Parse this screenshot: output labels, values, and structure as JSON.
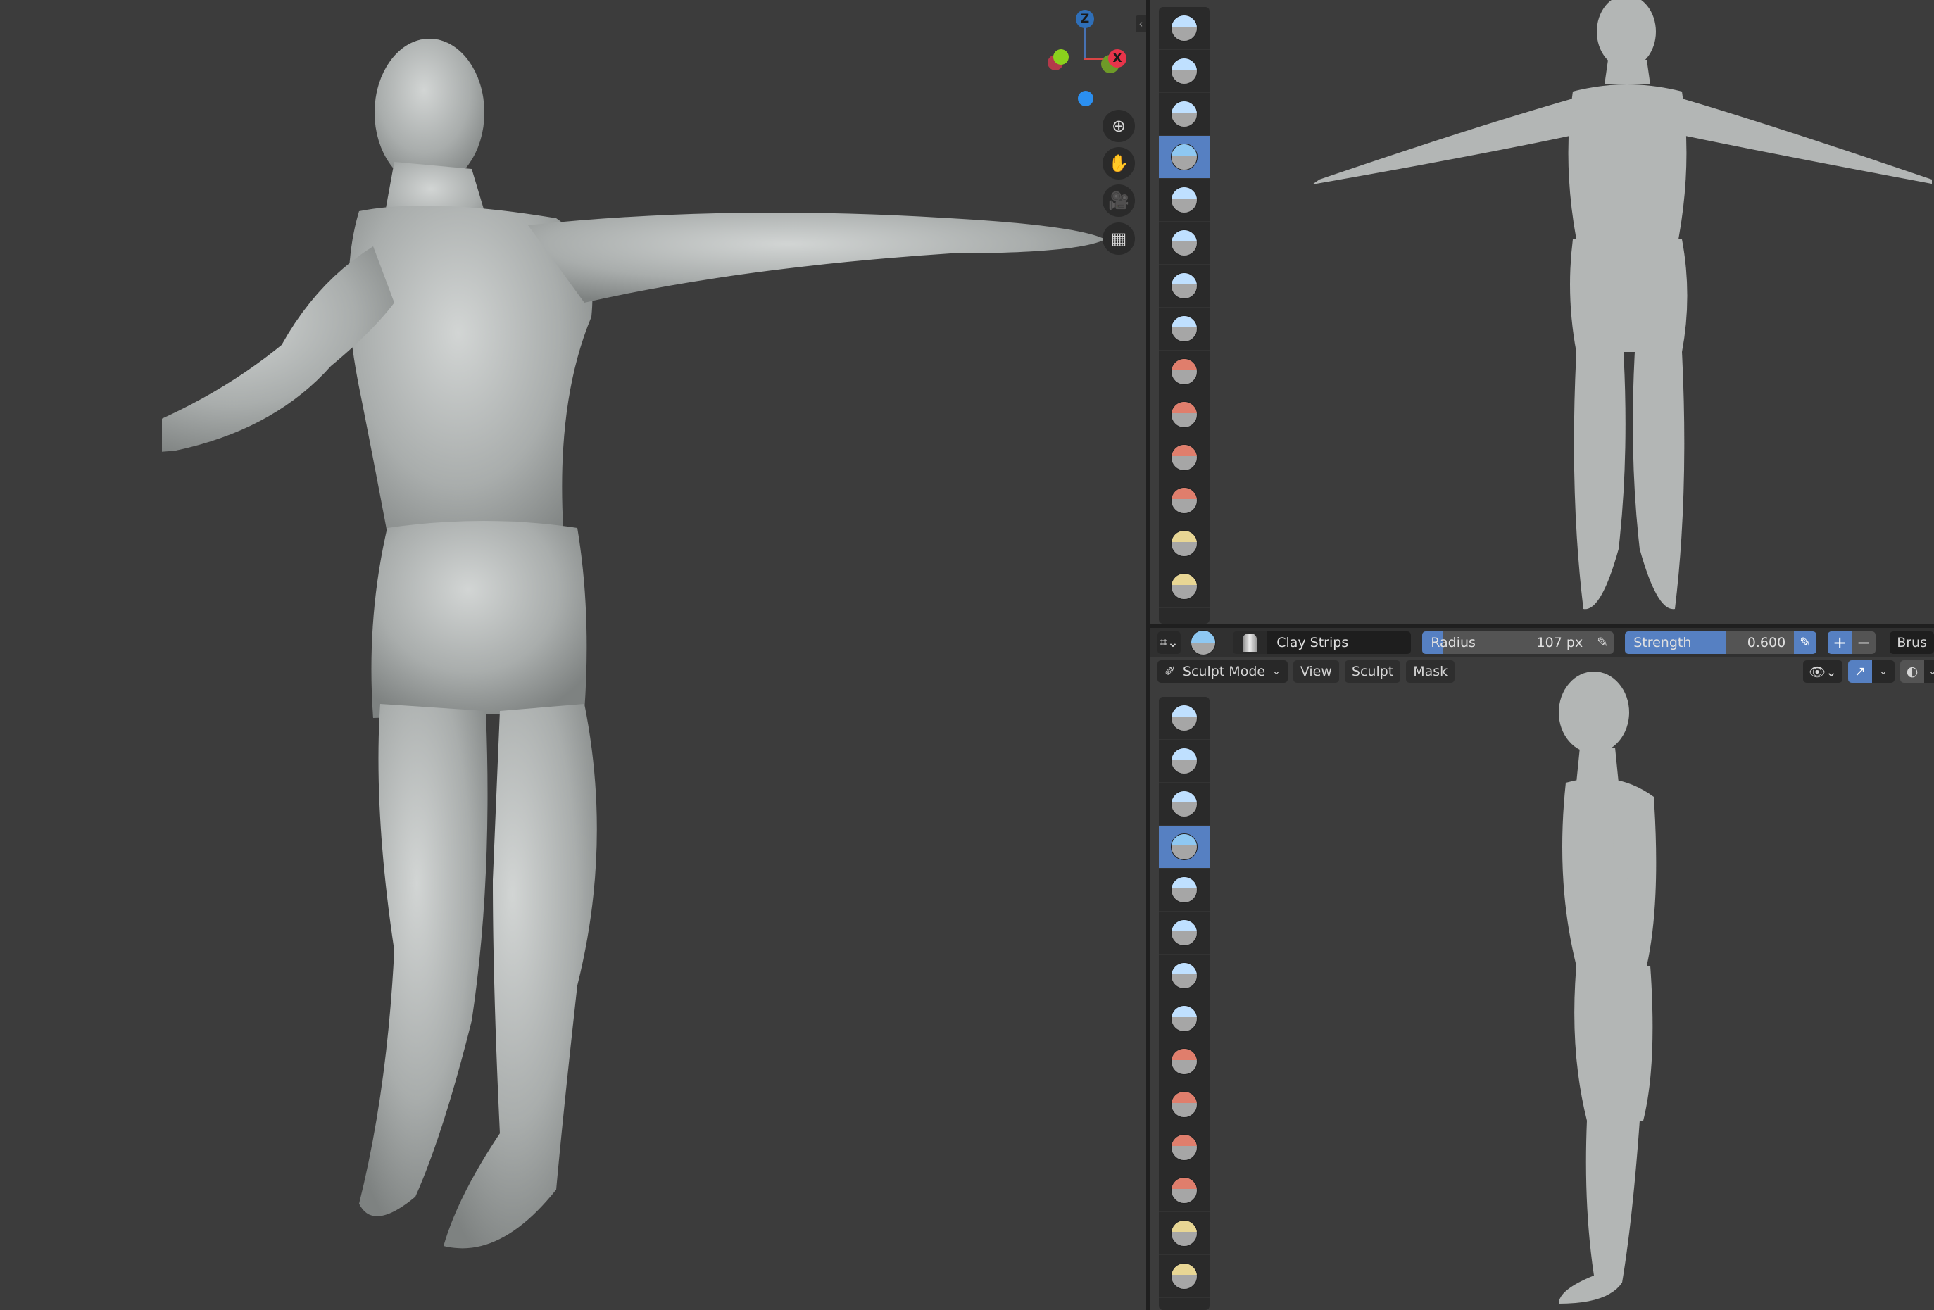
{
  "app": "Blender",
  "gizmo": {
    "axes": [
      {
        "label": "Z",
        "color": "#2f6fb8"
      },
      {
        "label": "X",
        "color": "#e8344a"
      },
      {
        "label": "",
        "color": "#7ccc1e"
      },
      {
        "label": "",
        "color": "#2b8ff0"
      }
    ]
  },
  "nav_controls": [
    {
      "name": "zoom-view",
      "icon": "magnifier-plus"
    },
    {
      "name": "pan-view",
      "icon": "hand"
    },
    {
      "name": "camera-view",
      "icon": "camera"
    },
    {
      "name": "ortho-toggle",
      "icon": "grid"
    }
  ],
  "collapse_tab": "‹",
  "brush_tools": [
    {
      "name": "draw",
      "color": "#bfe0ff"
    },
    {
      "name": "draw-sharp",
      "color": "#bfe0ff"
    },
    {
      "name": "clay",
      "color": "#bfe0ff"
    },
    {
      "name": "clay-strips",
      "color": "#8ec8f2",
      "active": true
    },
    {
      "name": "clay-thumb",
      "color": "#bfe0ff"
    },
    {
      "name": "layer",
      "color": "#bfe0ff"
    },
    {
      "name": "inflate",
      "color": "#bfe0ff"
    },
    {
      "name": "blob",
      "color": "#bfe0ff"
    },
    {
      "name": "crease",
      "color": "#e07e6c"
    },
    {
      "name": "smooth",
      "color": "#e07e6c"
    },
    {
      "name": "flatten",
      "color": "#e07e6c"
    },
    {
      "name": "fill",
      "color": "#e07e6c"
    },
    {
      "name": "scrape",
      "color": "#e8d694"
    },
    {
      "name": "multiplane-scrape",
      "color": "#e8d694"
    }
  ],
  "header": {
    "brush_name": "Clay Strips",
    "radius": {
      "label": "Radius",
      "value": "107 px",
      "fill_fraction": 0.12
    },
    "strength": {
      "label": "Strength",
      "value": "0.600",
      "fill_fraction": 0.6
    },
    "plus": "+",
    "minus": "−",
    "brush_menu_partial": "Brus",
    "mode": "Sculpt Mode",
    "menus": [
      "View",
      "Sculpt",
      "Mask"
    ]
  }
}
